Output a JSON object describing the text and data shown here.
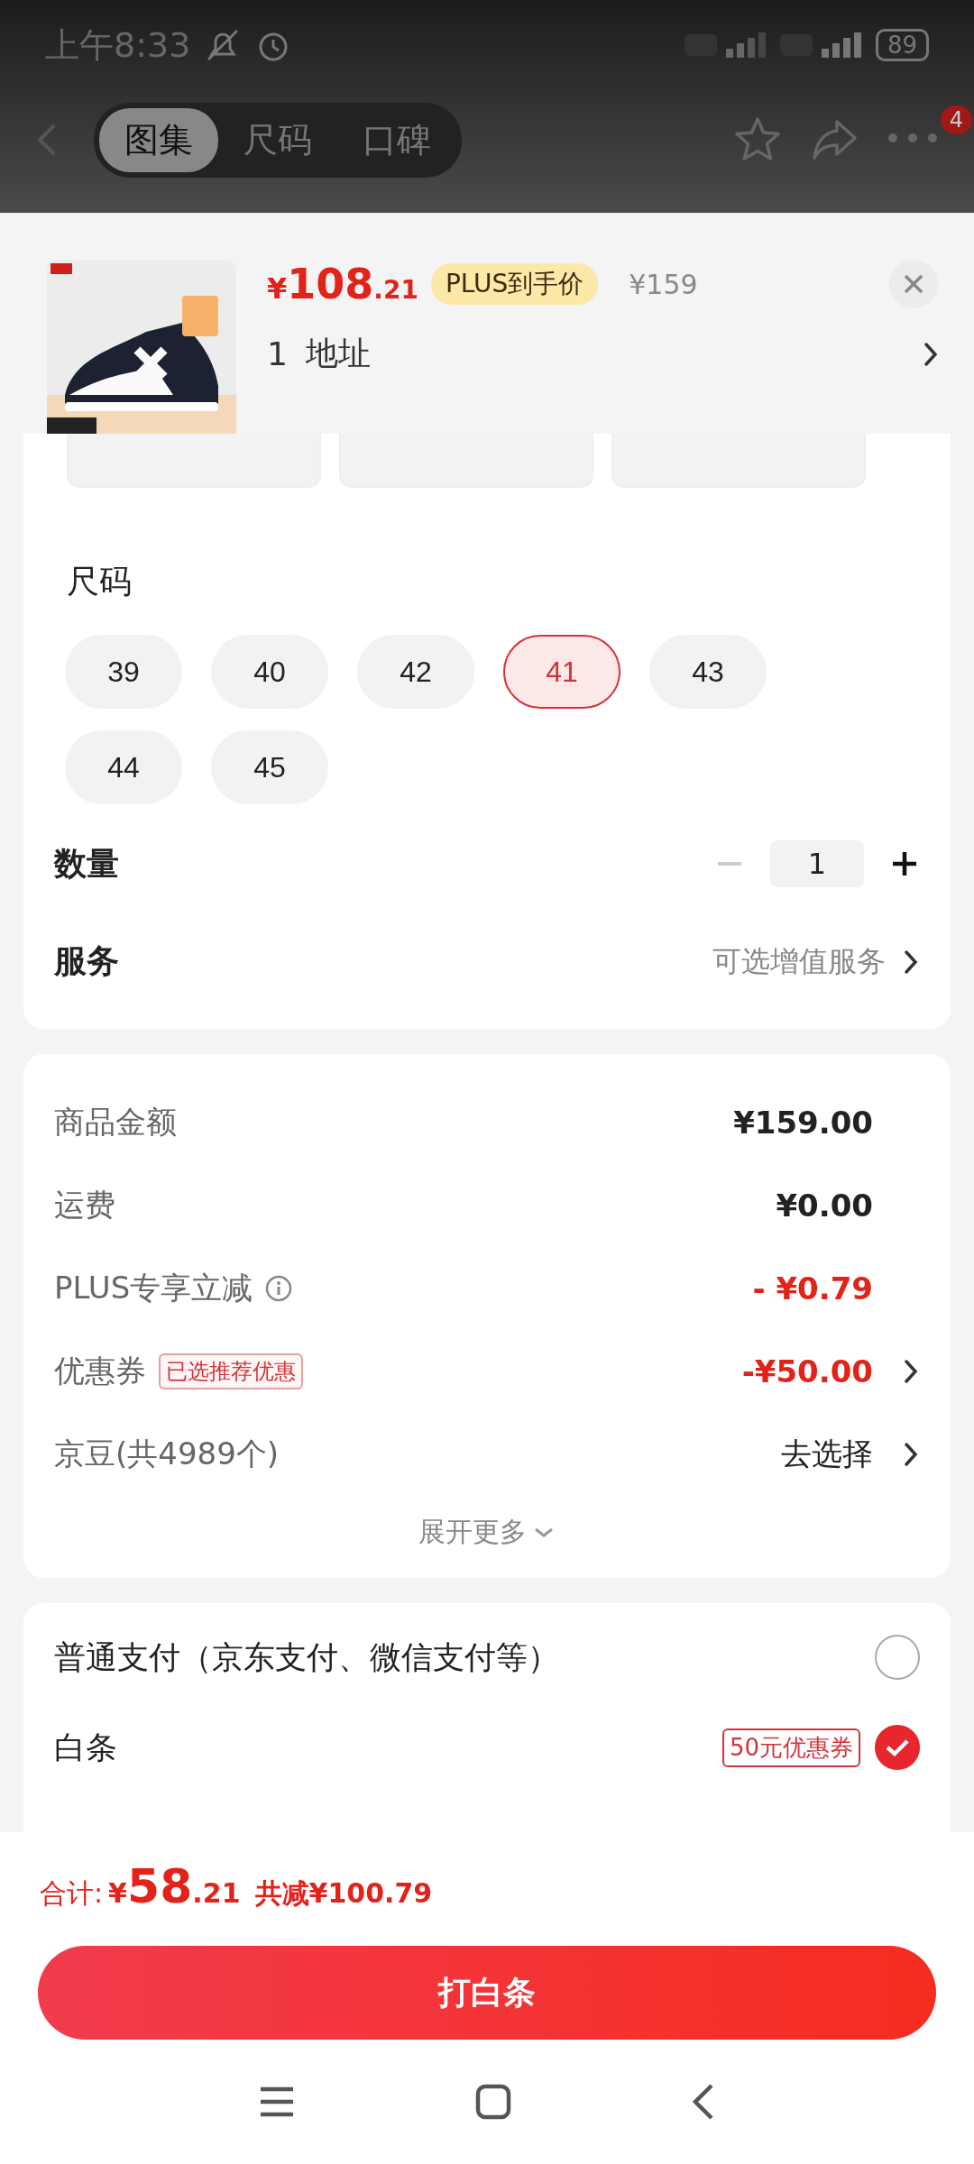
{
  "status_bar": {
    "time": "上午8:33",
    "battery": "89"
  },
  "header": {
    "tabs": [
      {
        "label": "图集",
        "selected": true
      },
      {
        "label": "尺码",
        "selected": false
      },
      {
        "label": "口碑",
        "selected": false
      }
    ],
    "badge": "4"
  },
  "product": {
    "price_symbol": "¥",
    "price_int": "108",
    "price_dec": ".21",
    "plus_tag": "PLUS到手价",
    "original_price": "¥159",
    "address_count": "1",
    "address_label": "地址"
  },
  "colors": [
    {
      "kind": "option"
    },
    {
      "kind": "option"
    },
    {
      "kind": "option"
    }
  ],
  "size_title": "尺码",
  "sizes": [
    {
      "label": "39",
      "selected": false
    },
    {
      "label": "40",
      "selected": false
    },
    {
      "label": "42",
      "selected": false
    },
    {
      "label": "41",
      "selected": true
    },
    {
      "label": "43",
      "selected": false
    },
    {
      "label": "44",
      "selected": false
    },
    {
      "label": "45",
      "selected": false
    }
  ],
  "quantity": {
    "label": "数量",
    "value": "1",
    "minus_disabled": true
  },
  "service": {
    "label": "服务",
    "value": "可选增值服务"
  },
  "fees": [
    {
      "label": "商品金额",
      "value": "¥159.00",
      "kind": "amount",
      "chevron": false
    },
    {
      "label": "运费",
      "value": "¥0.00",
      "kind": "amount",
      "chevron": false
    },
    {
      "label": "PLUS专享立减",
      "value": "- ¥0.79",
      "kind": "discount",
      "info": true,
      "chevron": false
    },
    {
      "label": "优惠券",
      "tag": "已选推荐优惠",
      "value": "-¥50.00",
      "kind": "discount",
      "chevron": true
    },
    {
      "label": "京豆(共4989个)",
      "value": "去选择",
      "kind": "action",
      "chevron": true
    }
  ],
  "expand": "展开更多",
  "payments": [
    {
      "label": "普通支付（京东支付、微信支付等）",
      "selected": false
    },
    {
      "label": "白条",
      "tag": "50元优惠券",
      "selected": true
    }
  ],
  "footer": {
    "total_label": "合计:",
    "total_symbol": "¥",
    "total_int": "58",
    "total_dec": ".21",
    "saved": "共减¥100.79",
    "button": "打白条"
  }
}
